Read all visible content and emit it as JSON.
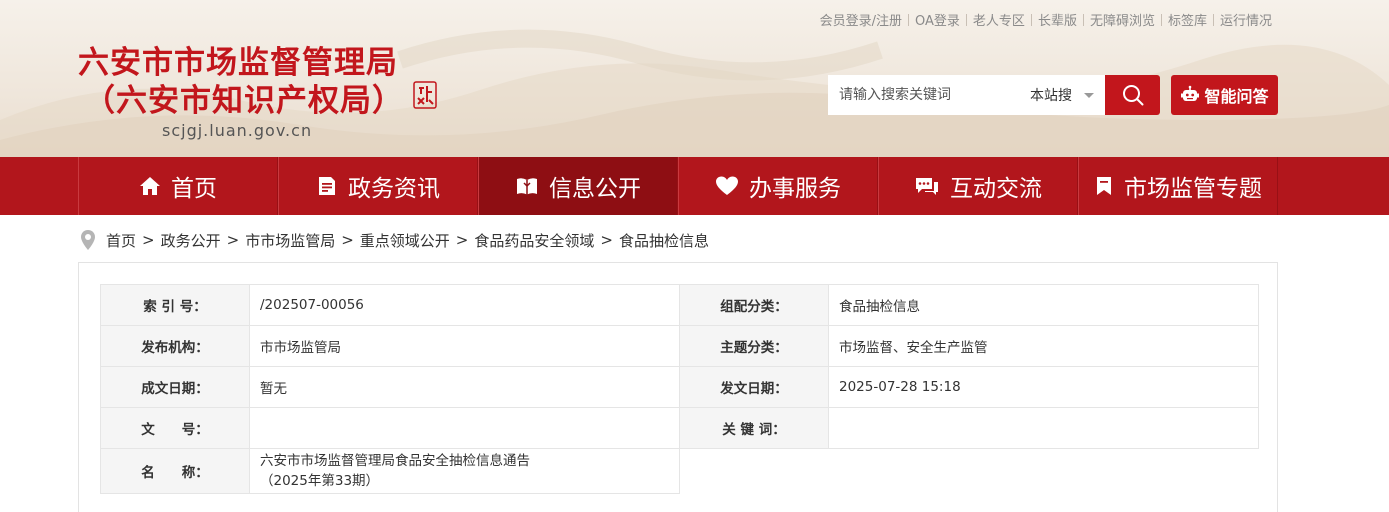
{
  "top_links": [
    "会员登录/注册",
    "OA登录",
    "老人专区",
    "长辈版",
    "无障碍浏览",
    "标签库",
    "运行情况"
  ],
  "site": {
    "title_line1": "六安市市场监督管理局",
    "title_line2": "（六安市知识产权局）",
    "domain": "scjgj.luan.gov.cn",
    "brand_color": "#c2161c"
  },
  "search": {
    "placeholder": "请输入搜索关键词",
    "scope": "本站搜",
    "button_icon": "search-icon"
  },
  "ai_button": {
    "label": "智能问答",
    "icon": "robot-icon"
  },
  "nav": {
    "items": [
      {
        "label": "首页",
        "icon": "home-icon"
      },
      {
        "label": "政务资讯",
        "icon": "news-icon"
      },
      {
        "label": "信息公开",
        "icon": "open-book-icon",
        "active": true
      },
      {
        "label": "办事服务",
        "icon": "heart-icon"
      },
      {
        "label": "互动交流",
        "icon": "chat-icon"
      },
      {
        "label": "市场监管专题",
        "icon": "bookmark-icon"
      }
    ]
  },
  "breadcrumb": {
    "icon": "location-pin-icon",
    "items": [
      "首页",
      "政务公开",
      "市市场监管局",
      "重点领域公开",
      "食品药品安全领域",
      "食品抽检信息"
    ],
    "separator": ">"
  },
  "meta": {
    "index_label": "索 引 号：",
    "index_value": "/202507-00056",
    "category_label": "组配分类：",
    "category_value": "食品抽检信息",
    "publisher_label": "发布机构：",
    "publisher_value": "市市场监管局",
    "topic_label": "主题分类：",
    "topic_value": "市场监督、安全生产监管",
    "created_label": "成文日期：",
    "created_value": "暂无",
    "issued_label": "发文日期：",
    "issued_value": "2025-07-28 15:18",
    "docno_label": "文　　号：",
    "docno_value": "",
    "keywords_label": "关 键 词：",
    "keywords_value": "",
    "name_label": "名　　称：",
    "name_value_line1": "六安市市场监督管理局食品安全抽检信息通告",
    "name_value_line2": "（2025年第33期）"
  }
}
